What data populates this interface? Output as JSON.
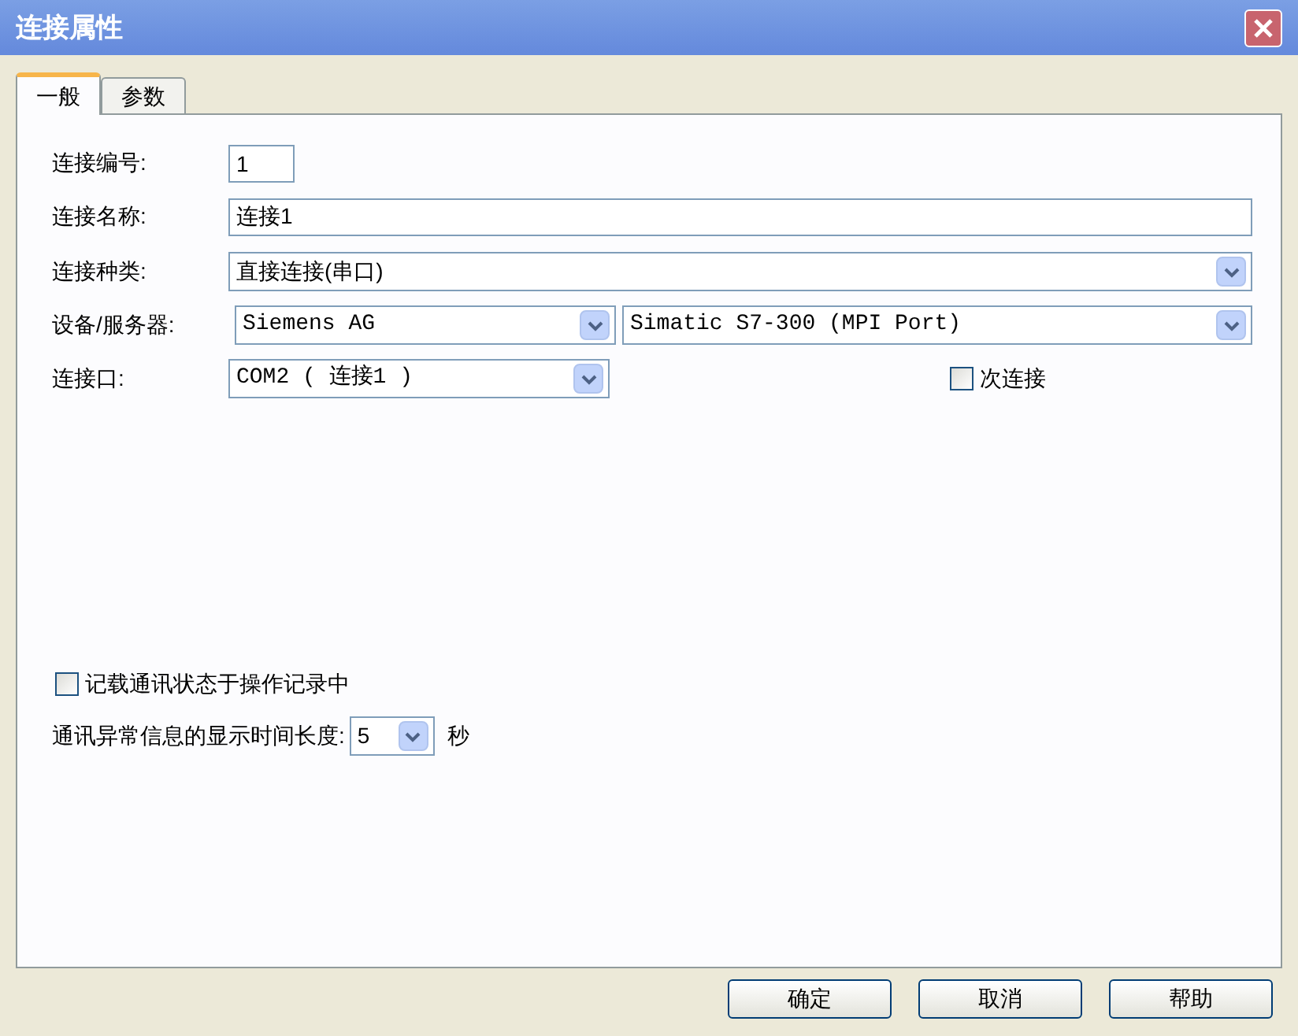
{
  "window": {
    "title": "连接属性"
  },
  "tabs": [
    {
      "label": "一般",
      "selected": true
    },
    {
      "label": "参数",
      "selected": false
    }
  ],
  "fields": {
    "number": {
      "label": "连接编号:",
      "value": "1"
    },
    "name": {
      "label": "连接名称:",
      "value": "连接1"
    },
    "type": {
      "label": "连接种类:",
      "value": "直接连接(串口)"
    },
    "device": {
      "label": "设备/服务器:",
      "vendor": "Siemens AG",
      "model": "Simatic S7-300 (MPI Port)"
    },
    "port": {
      "label": "连接口:",
      "value": "COM2 ( 连接1 )"
    },
    "secondary": {
      "label": "次连接",
      "checked": false
    }
  },
  "log_checkbox": {
    "label": "记载通讯状态于操作记录中",
    "checked": false
  },
  "error_display": {
    "label": "通讯异常信息的显示时间长度:",
    "value": "5",
    "unit": "秒"
  },
  "buttons": [
    "确定",
    "取消",
    "帮助"
  ]
}
